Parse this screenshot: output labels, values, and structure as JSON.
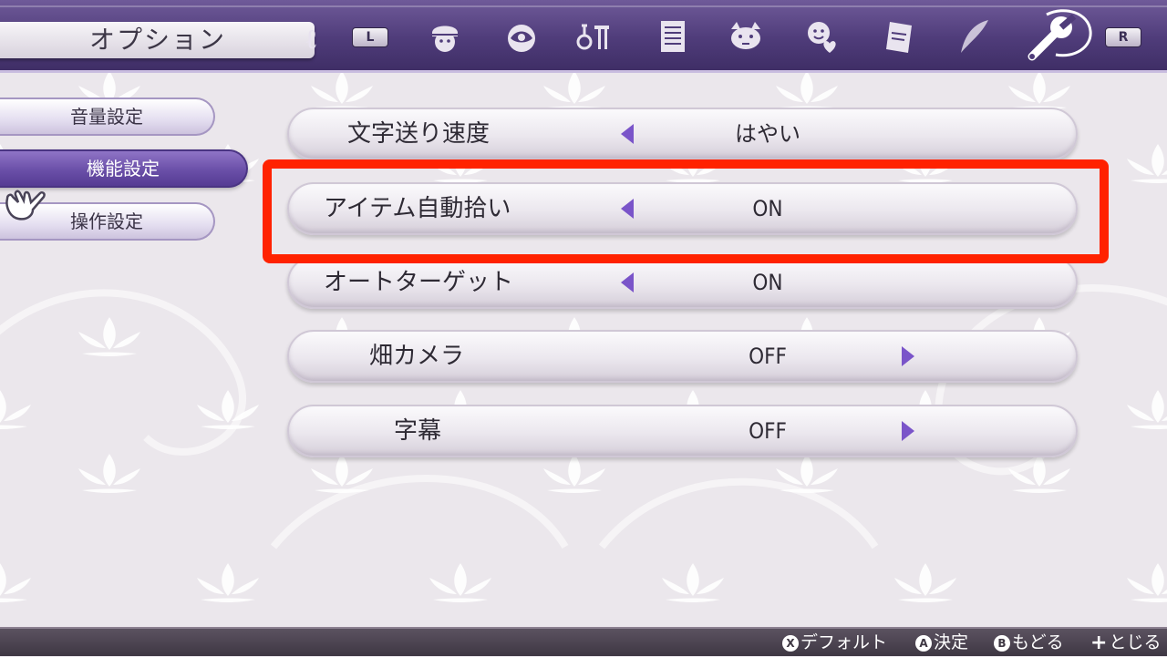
{
  "header": {
    "title": "オプション",
    "left_shoulder": "L",
    "right_shoulder": "R",
    "tabs": [
      {
        "icon": "character-face-icon"
      },
      {
        "icon": "orb-eye-icon"
      },
      {
        "icon": "weapon-rack-icon"
      },
      {
        "icon": "document-list-icon"
      },
      {
        "icon": "animal-icon"
      },
      {
        "icon": "heart-face-icon"
      },
      {
        "icon": "book-icon"
      },
      {
        "icon": "quill-icon"
      },
      {
        "icon": "wrench-icon",
        "active": true
      }
    ]
  },
  "sidebar": {
    "items": [
      {
        "label": "音量設定",
        "selected": false
      },
      {
        "label": "機能設定",
        "selected": true
      },
      {
        "label": "操作設定",
        "selected": false
      }
    ]
  },
  "options": [
    {
      "label": "文字送り速度",
      "value": "はやい",
      "arrow": "left"
    },
    {
      "label": "アイテム自動拾い",
      "value": "ON",
      "arrow": "left",
      "highlighted": true
    },
    {
      "label": "オートターゲット",
      "value": "ON",
      "arrow": "left"
    },
    {
      "label": "畑カメラ",
      "value": "OFF",
      "arrow": "right"
    },
    {
      "label": "字幕",
      "value": "OFF",
      "arrow": "right"
    }
  ],
  "footer": {
    "hints": [
      {
        "button": "X",
        "label": "デフォルト"
      },
      {
        "button": "A",
        "label": "決定"
      },
      {
        "button": "B",
        "label": "もどる"
      },
      {
        "button": "+",
        "label": "とじる"
      }
    ]
  },
  "colors": {
    "header_purple": "#4f3c7a",
    "selected_purple": "#6a4fa8",
    "arrow_purple": "#7a54c9",
    "highlight_red": "#ff2200"
  }
}
